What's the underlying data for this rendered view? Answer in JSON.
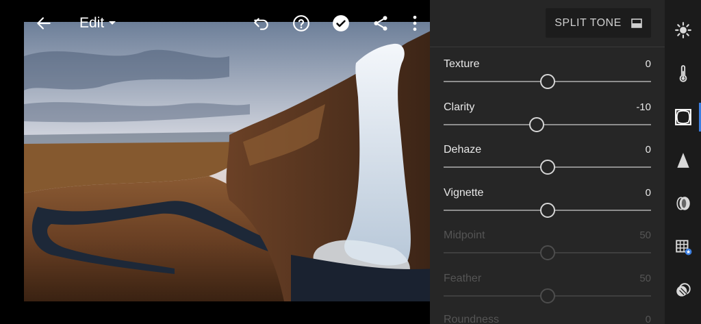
{
  "toolbar": {
    "edit_label": "Edit"
  },
  "panel": {
    "split_tone_label": "SPLIT TONE",
    "sliders": [
      {
        "label": "Texture",
        "value": "0",
        "position": 0.5,
        "enabled": true
      },
      {
        "label": "Clarity",
        "value": "-10",
        "position": 0.45,
        "enabled": true
      },
      {
        "label": "Dehaze",
        "value": "0",
        "position": 0.5,
        "enabled": true
      },
      {
        "label": "Vignette",
        "value": "0",
        "position": 0.5,
        "enabled": true
      },
      {
        "label": "Midpoint",
        "value": "50",
        "position": 0.5,
        "enabled": false
      },
      {
        "label": "Feather",
        "value": "50",
        "position": 0.5,
        "enabled": false
      },
      {
        "label": "Roundness",
        "value": "0",
        "position": 0.5,
        "enabled": false
      }
    ]
  },
  "rail": {
    "items": [
      "light-icon",
      "color-temperature-icon",
      "effects-icon",
      "detail-icon",
      "optics-icon",
      "geometry-icon",
      "presets-icon"
    ],
    "active": "effects-icon",
    "accent": "#3b7ee0"
  }
}
